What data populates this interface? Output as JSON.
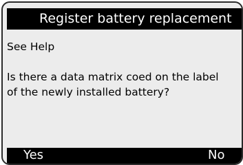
{
  "header": {
    "title": "Register battery replacement"
  },
  "content": {
    "help_text": "See Help",
    "question": "Is there a data matrix coed on the label\nof the newly installed battery?"
  },
  "softkeys": {
    "yes_label": "Yes",
    "no_label": "No"
  },
  "colors": {
    "bar_background": "#000000",
    "bar_text": "#ffffff",
    "screen_background": "#ececec",
    "body_text": "#000000"
  }
}
